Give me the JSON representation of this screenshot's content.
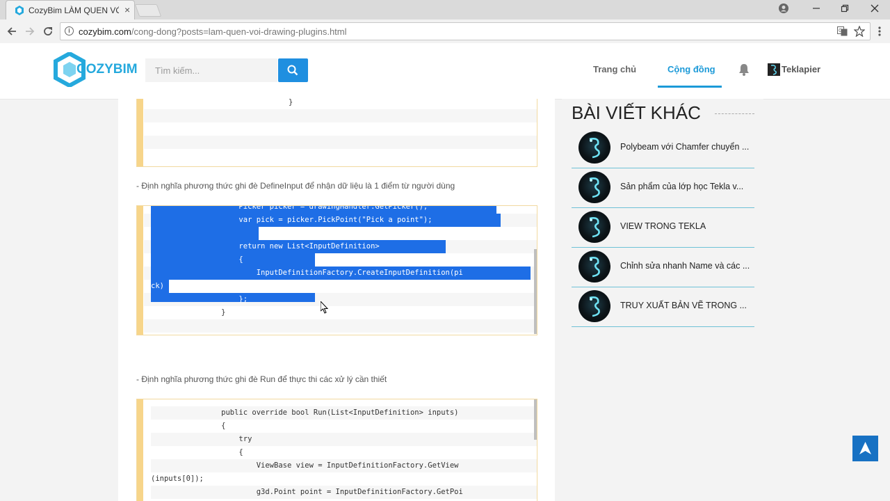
{
  "browser": {
    "tab_title": "CozyBim LÀM QUEN VỚI",
    "tab_close": "×",
    "url_host": "cozybim.com",
    "url_path": "/cong-dong?posts=lam-quen-voi-drawing-plugins.html"
  },
  "header": {
    "logo_text": "COZYBIM",
    "search_placeholder": "Tìm kiếm...",
    "nav": {
      "home": "Trang chủ",
      "community": "Cộng đồng"
    },
    "user_name": "Teklapier"
  },
  "article": {
    "block1_lines": [
      "}",
      "",
      "",
      "",
      ""
    ],
    "para1": "- Định nghĩa phương thức ghi đè DefineInput để nhận dữ liệu là 1 điểm từ người dùng",
    "block2_lines": [
      "                    Picker picker = drawingHandler.GetPicker();",
      "                    var pick = picker.PickPoint(\"Pick a point\");",
      "",
      "                    return new List<InputDefinition>",
      "                    {",
      "                        InputDefinitionFactory.CreateInputDefinition(pi",
      "ck)",
      "                    };",
      "                }"
    ],
    "para2": "- Định nghĩa phương thức ghi đè Run để thực thi các xử lý cần thiết",
    "block3_lines": [
      "",
      "                public override bool Run(List<InputDefinition> inputs)",
      "                {",
      "                    try",
      "                    {",
      "                        ViewBase view = InputDefinitionFactory.GetView",
      "(inputs[0]);",
      "                        g3d.Point point = InputDefinitionFactory.GetPoi"
    ]
  },
  "sidebar": {
    "title": "BÀI VIẾT KHÁC",
    "posts": [
      {
        "title": "Polybeam với Chamfer chuyển ..."
      },
      {
        "title": "Sản phẩm của lớp học Tekla v..."
      },
      {
        "title": "VIEW TRONG TEKLA"
      },
      {
        "title": "Chỉnh sửa nhanh Name và các ..."
      },
      {
        "title": "TRUY XUẤT BẢN VẼ TRONG ..."
      }
    ]
  },
  "colors": {
    "accent": "#1c9ad8",
    "selection": "#1e6ee6",
    "code_bar": "#f7d58a"
  }
}
